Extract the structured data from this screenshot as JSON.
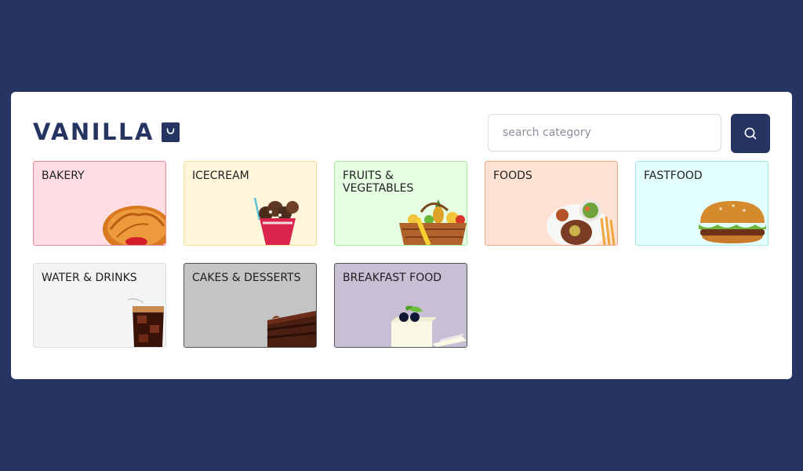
{
  "brand": {
    "name": "VANILLA",
    "icon": "shopping-bag-icon",
    "color": "#263461"
  },
  "search": {
    "placeholder": "search category",
    "value": "",
    "button_icon": "search-icon"
  },
  "categories": [
    {
      "label": "BAKERY",
      "bg": "#ffdde2",
      "border": "#e88a98",
      "icon": "croissant-icon"
    },
    {
      "label": "ICECREAM",
      "bg": "#fff6db",
      "border": "#f1df98",
      "icon": "ice-cream-sundae-icon"
    },
    {
      "label": "FRUITS & VEGETABLES",
      "bg": "#e6ffe3",
      "border": "#a9e8a1",
      "icon": "fruit-basket-icon"
    },
    {
      "label": "FOODS",
      "bg": "#ffe2d4",
      "border": "#f0a988",
      "icon": "plated-meal-icon"
    },
    {
      "label": "FASTFOOD",
      "bg": "#e3fffd",
      "border": "#9ee9e3",
      "icon": "burger-icon"
    },
    {
      "label": "WATER & DRINKS",
      "bg": "#f3f4f6",
      "border": "#dcdee3",
      "icon": "cola-glass-icon"
    },
    {
      "label": "CAKES & DESSERTS",
      "bg": "#c4c4c4",
      "border": "#555555",
      "icon": "chocolate-cake-icon"
    },
    {
      "label": "BREAKFAST FOOD",
      "bg": "#c7bfd3",
      "border": "#555555",
      "icon": "cheesecake-icon"
    }
  ]
}
